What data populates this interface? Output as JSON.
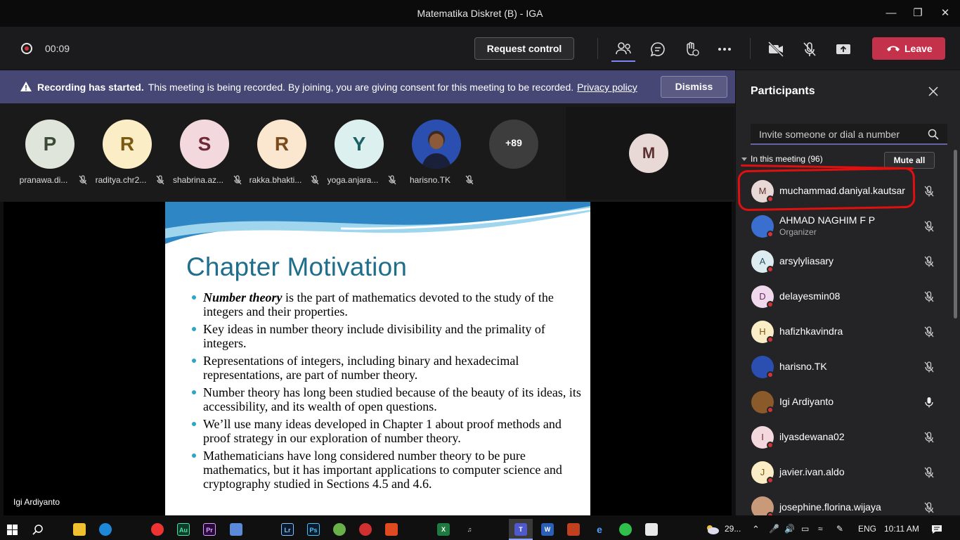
{
  "window": {
    "title": "Matematika Diskret (B) - IGA"
  },
  "call": {
    "timer": "00:09",
    "request_control": "Request control",
    "leave": "Leave"
  },
  "banner": {
    "bold": "Recording has started.",
    "text": "This meeting is being recorded. By joining, you are giving consent for this meeting to be recorded.",
    "link": "Privacy policy",
    "dismiss": "Dismiss"
  },
  "strip": {
    "tiles": [
      {
        "initial": "P",
        "name": "pranawa.di...",
        "bg": "#dfe5da",
        "fg": "#3d4a35"
      },
      {
        "initial": "R",
        "name": "raditya.chr2...",
        "bg": "#fbeec6",
        "fg": "#7a5a12"
      },
      {
        "initial": "S",
        "name": "shabrina.az...",
        "bg": "#f3d9dd",
        "fg": "#6b2a35"
      },
      {
        "initial": "R",
        "name": "rakka.bhakti...",
        "bg": "#fbe7cf",
        "fg": "#7a4a1a"
      },
      {
        "initial": "Y",
        "name": "yoga.anjara...",
        "bg": "#dcf0f0",
        "fg": "#1f5f66"
      },
      {
        "initial": "",
        "name": "harisno.TK",
        "bg": "#2a4fb0",
        "fg": "#ffffff"
      }
    ],
    "more": "+89",
    "m_initial": "M"
  },
  "slide": {
    "title": "Chapter Motivation",
    "bullets": [
      {
        "em": "Number theory",
        "text": " is the part of mathematics devoted to the study of the integers and their properties."
      },
      {
        "text": "Key ideas in number theory include divisibility and the primality of integers."
      },
      {
        "text": "Representations of integers, including binary and hexadecimal representations, are part of number theory."
      },
      {
        "text": "Number theory has long been studied because of the beauty of its ideas, its accessibility, and its wealth of open questions."
      },
      {
        "text": "We’ll use many ideas developed in Chapter 1 about proof methods and proof strategy in our exploration of number theory."
      },
      {
        "text": "Mathematicians have long considered number theory to be pure mathematics, but it has important applications to computer science and cryptography studied in Sections 4.5 and 4.6."
      }
    ],
    "presenter": "Igi Ardiyanto"
  },
  "panel": {
    "title": "Participants",
    "invite_placeholder": "Invite someone or dial a number",
    "section": "In this meeting (96)",
    "mute_all": "Mute all",
    "participants": [
      {
        "initial": "M",
        "name": "muchammad.daniyal.kautsar",
        "role": "",
        "bg": "#e8d9d6",
        "fg": "#5c3030",
        "mic": "muted"
      },
      {
        "initial": "",
        "name": "AHMAD NAGHIM F P",
        "role": "Organizer",
        "bg": "#3a6fd0",
        "fg": "#fff",
        "mic": "muted"
      },
      {
        "initial": "A",
        "name": "arsylyliasary",
        "role": "",
        "bg": "#dcecf0",
        "fg": "#2b5560",
        "mic": "muted"
      },
      {
        "initial": "D",
        "name": "delayesmin08",
        "role": "",
        "bg": "#f0d9ec",
        "fg": "#6b2a60",
        "mic": "muted"
      },
      {
        "initial": "H",
        "name": "hafizhkavindra",
        "role": "",
        "bg": "#fbeec6",
        "fg": "#7a5a12",
        "mic": "muted"
      },
      {
        "initial": "",
        "name": "harisno.TK",
        "role": "",
        "bg": "#2a4fb0",
        "fg": "#fff",
        "mic": "muted"
      },
      {
        "initial": "",
        "name": "Igi Ardiyanto",
        "role": "",
        "bg": "#8a5a2a",
        "fg": "#fff",
        "mic": "on"
      },
      {
        "initial": "I",
        "name": "ilyasdewana02",
        "role": "",
        "bg": "#f3d9dd",
        "fg": "#6b2a35",
        "mic": "muted"
      },
      {
        "initial": "J",
        "name": "javier.ivan.aldo",
        "role": "",
        "bg": "#fbeec6",
        "fg": "#7a5a12",
        "mic": "muted"
      },
      {
        "initial": "",
        "name": "josephine.florina.wijaya",
        "role": "",
        "bg": "#c89a7a",
        "fg": "#fff",
        "mic": "muted"
      }
    ]
  },
  "taskbar": {
    "weather": "29...",
    "lang": "ENG",
    "time": "10:11 AM"
  },
  "colors": {
    "accent": "#6264a7",
    "leave": "#c4314b",
    "banner": "#464775",
    "annotation": "#e01010"
  }
}
